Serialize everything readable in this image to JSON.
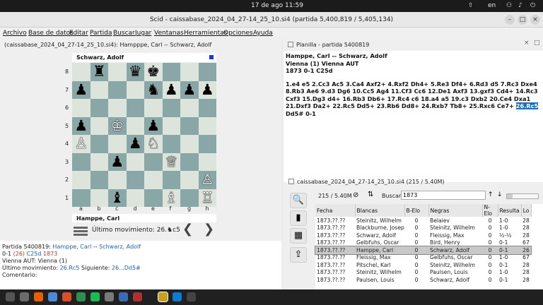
{
  "topbar": {
    "clock": "17 de ago  11:59",
    "lang": "en"
  },
  "window": {
    "title": "Scid - caissabase_2024_04_27-14_25_10.si4 (partida 5,400,819 / 5,405,134)"
  },
  "menu": [
    "Archivo",
    "Base de datos",
    "Editar",
    "Partida",
    "Buscar",
    "Jugar",
    "Ventanas",
    "Herramientas",
    "Opciones",
    "Ayuda"
  ],
  "board_tab": {
    "label": "(caissabase_2024_04_27-14_25_10.si4): Hampppe, Carl -- Schwarz, Adolf"
  },
  "board": {
    "top_player": "Schwarz, Adolf",
    "bottom_player": "Hamppe, Carl",
    "last_move_label": "Último movimiento: 26.♞c5",
    "prev_icon": "chevron-left-icon",
    "next_icon": "chevron-right-icon",
    "files": [
      "a",
      "b",
      "c",
      "d",
      "e",
      "f",
      "g",
      "h"
    ],
    "ranks": [
      "8",
      "7",
      "6",
      "5",
      "4",
      "3",
      "2",
      "1"
    ],
    "pieces": [
      {
        "sq": "b8",
        "g": "♜",
        "c": "b"
      },
      {
        "sq": "d8",
        "g": "♛",
        "c": "b"
      },
      {
        "sq": "e8",
        "g": "♚",
        "c": "b"
      },
      {
        "sq": "a7",
        "g": "♟",
        "c": "b"
      },
      {
        "sq": "e7",
        "g": "♞",
        "c": "b"
      },
      {
        "sq": "f7",
        "g": "♟",
        "c": "b"
      },
      {
        "sq": "g7",
        "g": "♟",
        "c": "b"
      },
      {
        "sq": "h7",
        "g": "♟",
        "c": "b"
      },
      {
        "sq": "a5",
        "g": "♟",
        "c": "b"
      },
      {
        "sq": "c5",
        "g": "♔",
        "c": "w"
      },
      {
        "sq": "e5",
        "g": "♟",
        "c": "b"
      },
      {
        "sq": "a4",
        "g": "♙",
        "c": "w"
      },
      {
        "sq": "d4",
        "g": "♟",
        "c": "b"
      },
      {
        "sq": "e4",
        "g": "♘",
        "c": "w"
      },
      {
        "sq": "c3",
        "g": "♟",
        "c": "b"
      },
      {
        "sq": "f3",
        "g": "♕",
        "c": "w"
      },
      {
        "sq": "h2",
        "g": "♙",
        "c": "w"
      },
      {
        "sq": "c1",
        "g": "♝",
        "c": "b"
      },
      {
        "sq": "f1",
        "g": "♗",
        "c": "w"
      },
      {
        "sq": "h1",
        "g": "♖",
        "c": "w"
      }
    ]
  },
  "info": {
    "line1_prefix": "Partida 5400819:",
    "white": "Hamppe, Carl",
    "sep": "--",
    "black": "Schwarz, Adolf",
    "result": "0-1",
    "ply": "(26)",
    "eco": "C25d",
    "year": "1873",
    "site_line": "Vienna AUT:  Vienna (1)",
    "last_move_prefix": "Último movimiento:",
    "last_move": "26.Rc5",
    "next_prefix": "Siguiente:",
    "next_move": "26...Dd5#",
    "comment": "Comentario:"
  },
  "notation": {
    "tab": "Planilla - partida 5400819",
    "header1": "Hamppe, Carl   --   Schwarz, Adolf",
    "header2": "Vienna (1)  Vienna AUT",
    "header3": "1873  0-1  C25d",
    "moves_before": "1.e4 e5 2.Cc3 Ac5 3.Ca4 Axf2+ 4.Rxf2 Dh4+ 5.Re3 Df4+ 6.Rd3 d5 7.Rc3 Dxe4 8.Rb3 Ae6 9.d3 Dg6 10.Cc5 Ag4 11.Cf3 Cc6 12.De1 Axf3 13.gxf3 Cd4+ 14.Rc3 Cxf3 15.Dg3 d4+ 16.Rb3 Db6+ 17.Rc4 c6 18.a4 a5 19.c3 Dxb2 20.Ce4 Dxa1 21.Dxf3 Da2+ 22.Rc5 Dd5+ 23.Rb6 Dd8+ 24.Rxb7 Tb8+ 25.Rxc6 Ce7+ ",
    "current_move": "26.Rc5",
    "moves_after": " Dd5# 0-1"
  },
  "gamelist": {
    "tab": "caissabase_2024_04_27-14_25_10.si4 (215 / 5.40M)",
    "count": "215 / 5.40M",
    "search_label": "Buscar",
    "search_value": "1873",
    "columns": [
      "Fecha",
      "Blancas",
      "B-Elo",
      "Negras",
      "N-Elo",
      "Resulta",
      "Lo"
    ],
    "rows": [
      [
        "1873.??.??",
        "Steinitz, Wilhelm",
        "0",
        "Belaiev",
        "0",
        "1-0",
        "28"
      ],
      [
        "1873.??.??",
        "Blackburne, Joseph",
        "0",
        "Steinitz, Wilhelm",
        "0",
        "1-0",
        "28"
      ],
      [
        "1873.??.??",
        "Schwarz, Adolf",
        "0",
        "Fleissig, Max",
        "0",
        "½-½",
        "28"
      ],
      [
        "1873.??.??",
        "Gelbfuhs, Oscar",
        "0",
        "Bird, Henry",
        "0",
        "0-1",
        "67"
      ],
      [
        "1873.??.??",
        "Hamppe, Carl",
        "0",
        "Schwarz, Adolf",
        "0",
        "0-1",
        "26"
      ],
      [
        "1873.??.??",
        "Fleissig, Max",
        "0",
        "Gelbfuhs, Oscar",
        "0",
        "1-0",
        "67"
      ],
      [
        "1873.??.??",
        "Pitschel, Karl",
        "0",
        "Steinitz, Wilhelm",
        "0",
        "0-1",
        "28"
      ],
      [
        "1873.??.??",
        "Steinitz, Wilhelm",
        "0",
        "Paulsen, Louis",
        "0",
        "1-0",
        "28"
      ],
      [
        "1873.??.??",
        "Paulsen, Louis",
        "0",
        "Schwarz, Adolf",
        "0",
        "0-1",
        "28"
      ]
    ],
    "selected_row": 4
  }
}
